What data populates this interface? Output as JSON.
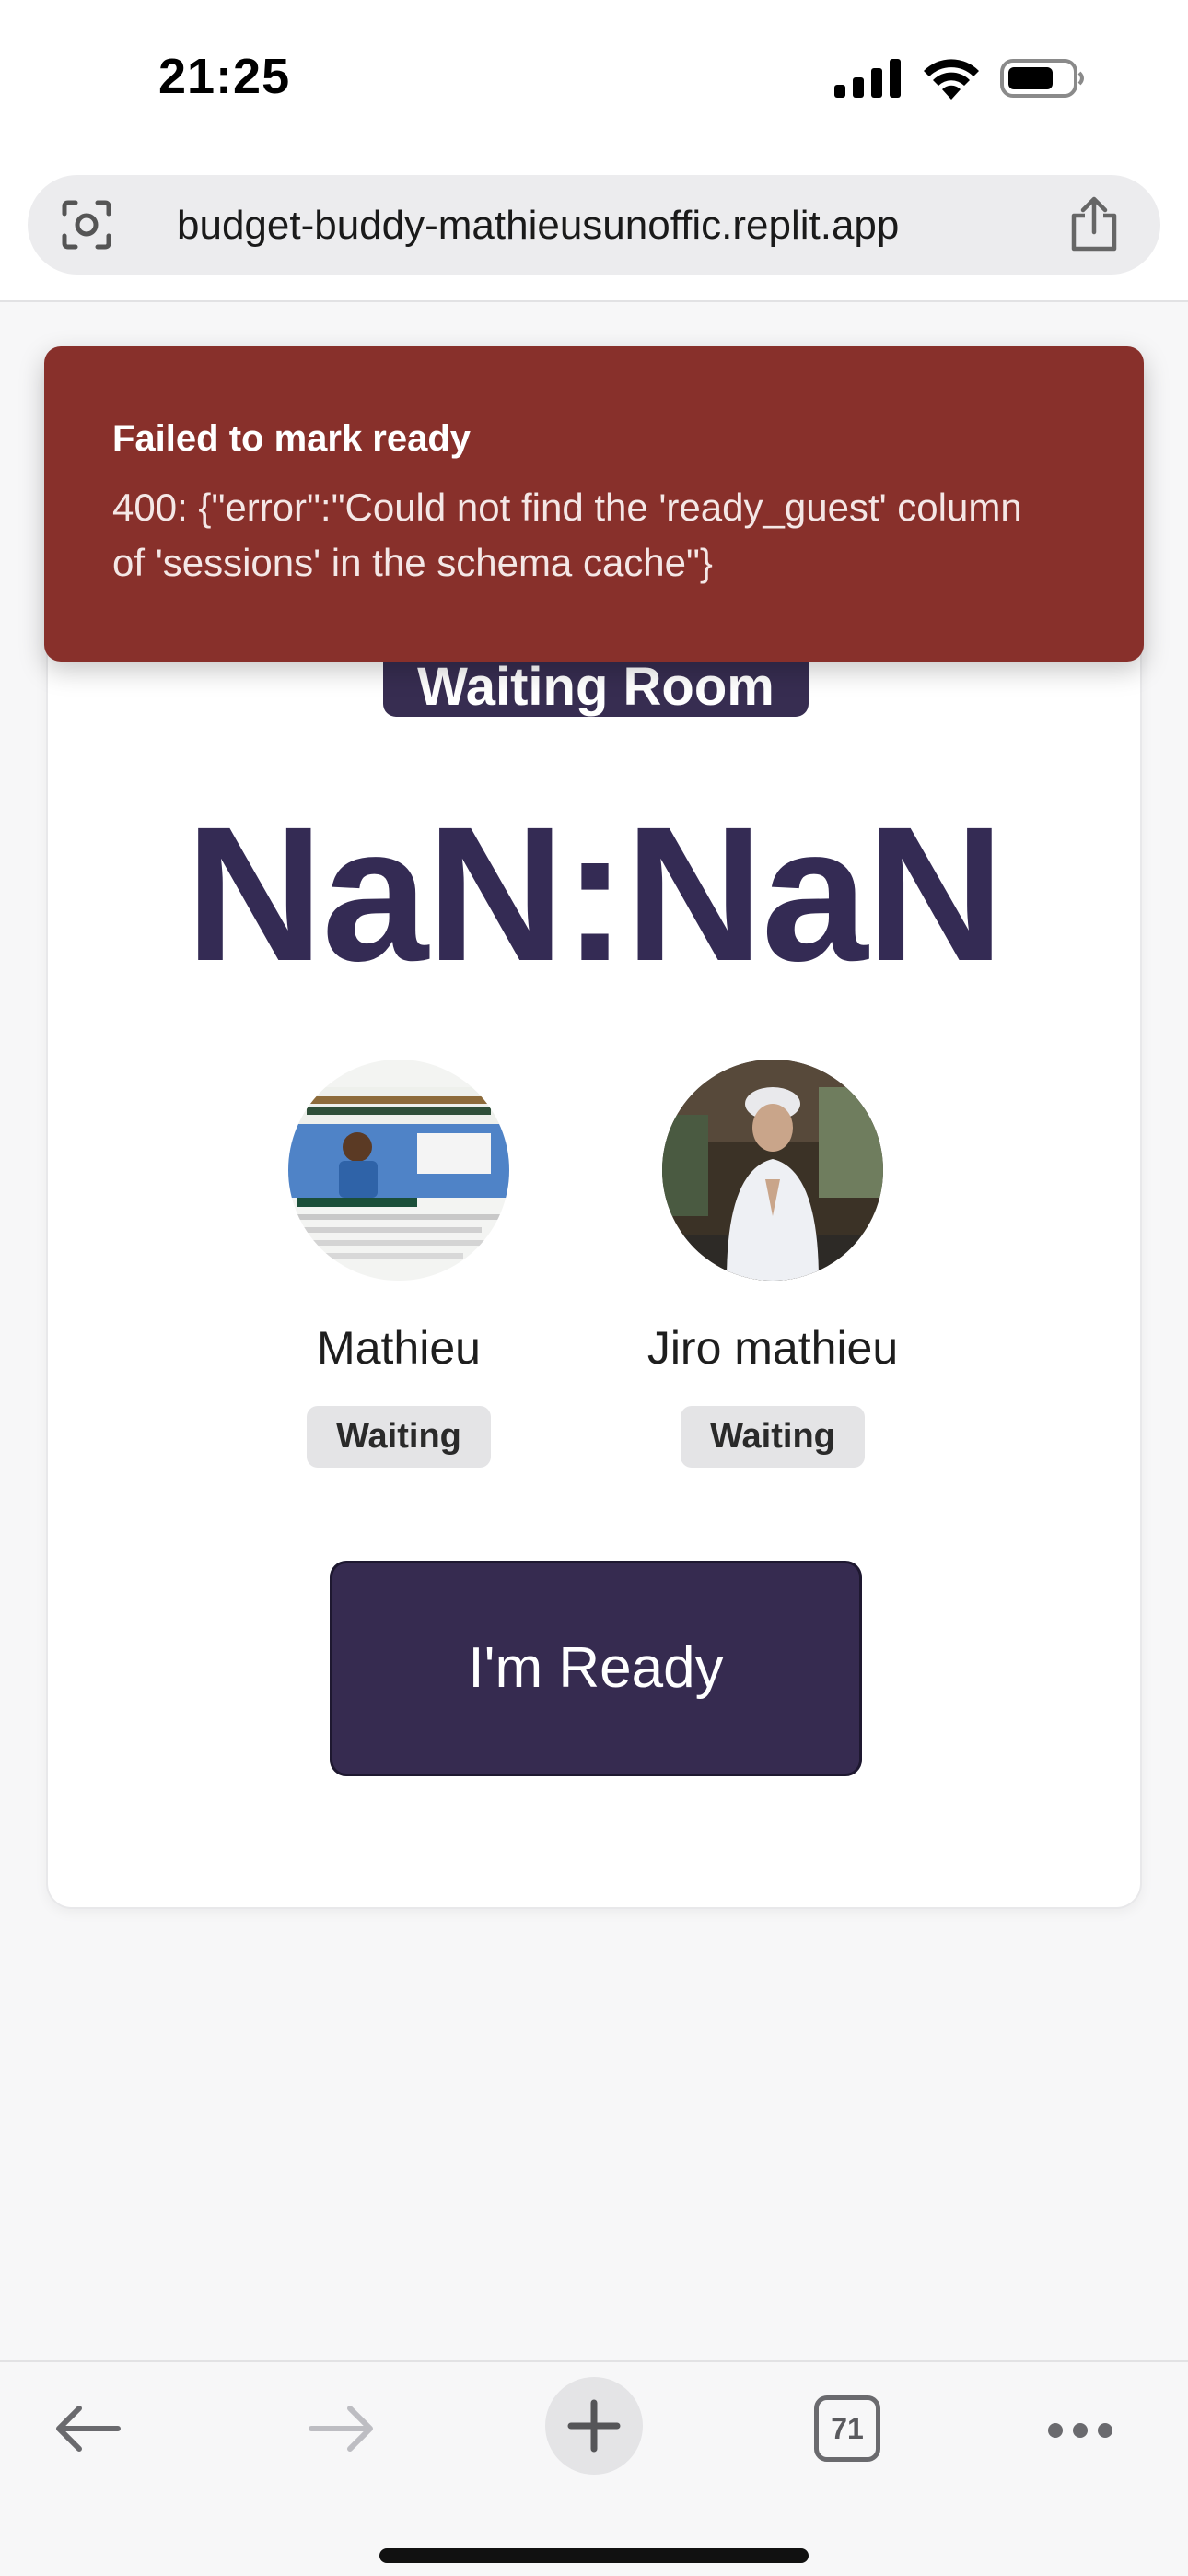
{
  "status_bar": {
    "time": "21:25",
    "icons": [
      "signal-icon",
      "wifi-icon",
      "battery-icon"
    ]
  },
  "browser": {
    "url": "budget-buddy-mathieusunoffic.replit.app",
    "icons": [
      "lens-icon",
      "share-icon"
    ]
  },
  "page": {
    "header_button": "Waiting Room",
    "timer": "NaN:NaN",
    "players": [
      {
        "name": "Mathieu",
        "status": "Waiting"
      },
      {
        "name": "Jiro mathieu",
        "status": "Waiting"
      }
    ],
    "ready_button": "I'm Ready"
  },
  "toast": {
    "title": "Failed to mark ready",
    "message": "400: {\"error\":\"Could not find the 'ready_guest' column of 'sessions' in the schema cache\"}"
  },
  "toolbar": {
    "tabs_count": "71",
    "icons": [
      "back-arrow-icon",
      "forward-arrow-icon",
      "plus-icon",
      "tabs-icon",
      "more-icon"
    ]
  },
  "colors": {
    "primary": "#362b50",
    "toast": "#88302b",
    "badge": "#e4e4e6"
  }
}
